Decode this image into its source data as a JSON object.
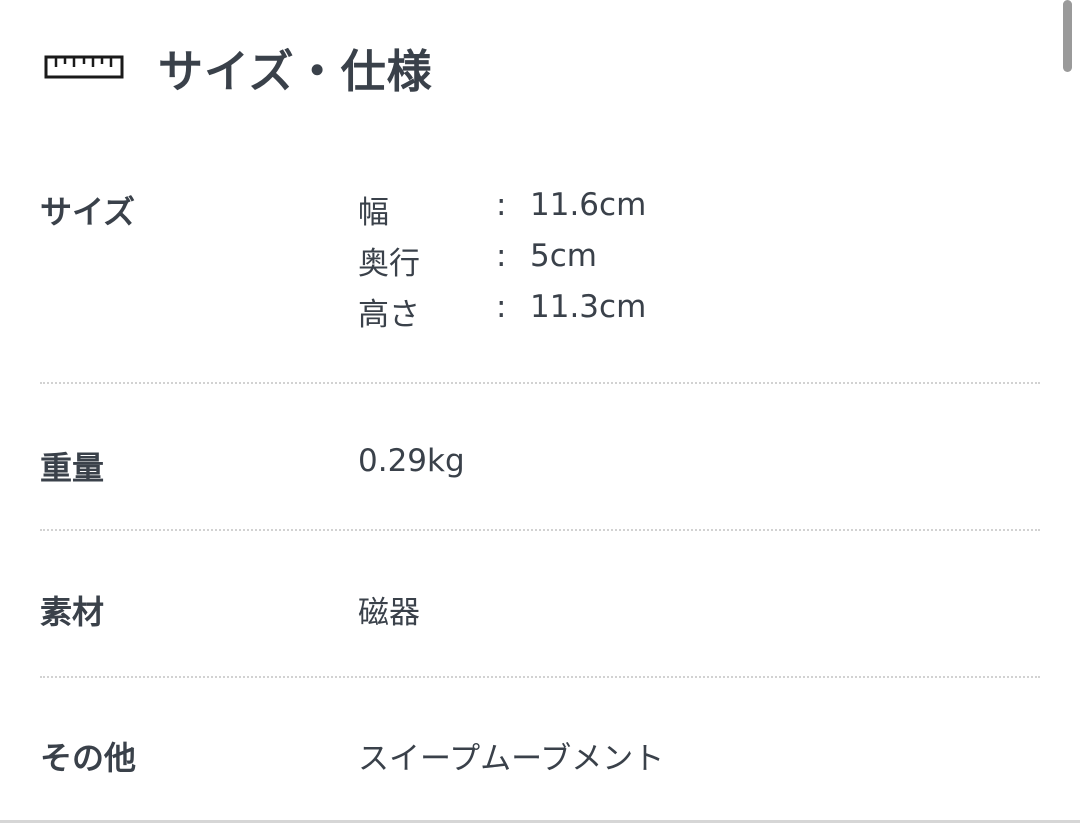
{
  "header": {
    "title": "サイズ・仕様",
    "icon": "ruler-icon"
  },
  "specs": {
    "size": {
      "label": "サイズ",
      "items": [
        {
          "key": "幅",
          "sep": ":",
          "value": "11.6cm"
        },
        {
          "key": "奥行",
          "sep": ":",
          "value": "5cm"
        },
        {
          "key": "高さ",
          "sep": ":",
          "value": "11.3cm"
        }
      ]
    },
    "weight": {
      "label": "重量",
      "value": "0.29kg"
    },
    "material": {
      "label": "素材",
      "value": "磁器"
    },
    "other": {
      "label": "その他",
      "value": "スイープムーブメント"
    }
  },
  "colors": {
    "text": "#3a414a",
    "divider": "#d2d2d2",
    "scrollbar": "#9a9a9a",
    "background": "#ffffff"
  }
}
